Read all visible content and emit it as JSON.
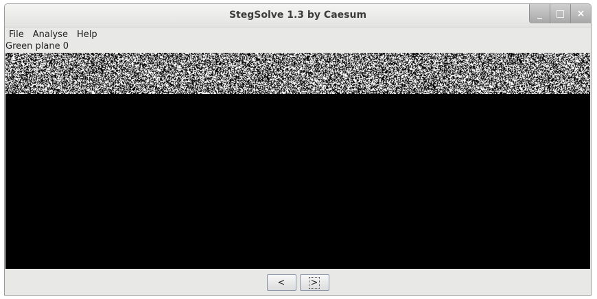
{
  "window": {
    "title": "StegSolve 1.3 by Caesum",
    "controls": {
      "minimize": "_",
      "maximize": "□",
      "close": "×"
    }
  },
  "menubar": {
    "items": [
      {
        "label": "File"
      },
      {
        "label": "Analyse"
      },
      {
        "label": "Help"
      }
    ]
  },
  "viewer": {
    "plane_label": "Green plane 0",
    "noise_color_light": "#ffffff",
    "noise_color_dark": "#000000",
    "background": "#000000"
  },
  "navigation": {
    "prev_label": "<",
    "next_label": ">"
  }
}
